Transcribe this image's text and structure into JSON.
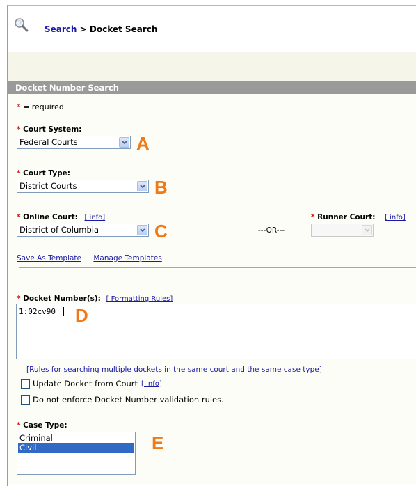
{
  "header": {
    "breadcrumb_link": "Search",
    "breadcrumb_sep": ">",
    "breadcrumb_current": "Docket Search"
  },
  "section_title": "Docket Number Search",
  "required_note": {
    "star": "*",
    "text": "= required"
  },
  "court_system": {
    "label": "Court System:",
    "value": "Federal Courts",
    "marker": "A"
  },
  "court_type": {
    "label": "Court Type:",
    "value": "District Courts",
    "marker": "B"
  },
  "online_court": {
    "label": "Online Court:",
    "info": "[ info]",
    "value": "District of Columbia",
    "marker": "C"
  },
  "or_text": "---OR---",
  "runner_court": {
    "label": "Runner Court:",
    "info": "[ info]",
    "value": ""
  },
  "templates": {
    "save": "Save As Template",
    "manage": "Manage Templates"
  },
  "docket_numbers": {
    "label": "Docket Number(s):",
    "rules_link": "[ Formatting Rules]",
    "value": "1:02cv90",
    "marker": "D"
  },
  "rules_multiple_link": "[Rules for searching multiple dockets in the same court and the same case type]",
  "update_docket": {
    "label": "Update Docket from Court",
    "info": "[ info]",
    "checked": false
  },
  "no_validation": {
    "label": "Do not enforce Docket Number validation rules.",
    "checked": false
  },
  "case_type": {
    "label": "Case Type:",
    "options": [
      "Criminal",
      "Civil"
    ],
    "selected": "Civil",
    "marker": "E"
  },
  "colors": {
    "accent_orange": "#f07a18",
    "link_blue": "#1a1aa6",
    "required_red": "#d01010",
    "section_bar": "#9a9a9a",
    "selection_blue": "#316ac5"
  }
}
